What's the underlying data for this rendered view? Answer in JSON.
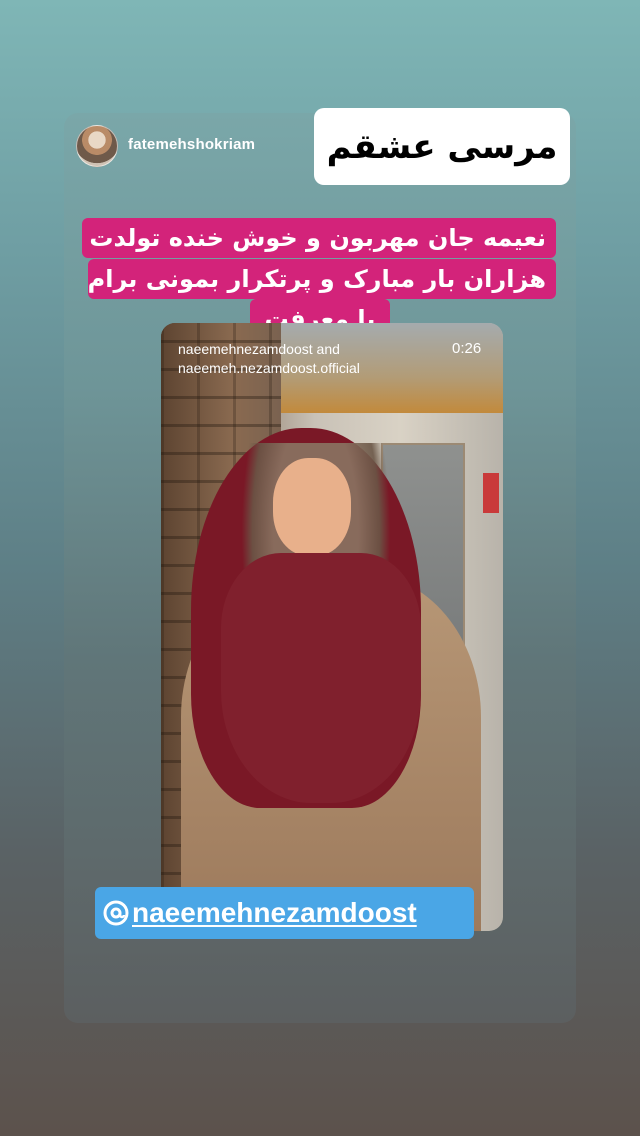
{
  "story": {
    "username": "fatemehshokriam",
    "white_sticker": "مرسی عشقم",
    "caption_lines": [
      "نعیمه جان مهربون و خوش خنده تولدت",
      "هزاران بار مبارک و پرتکرار بمونی برام",
      "با معرفت"
    ]
  },
  "reel": {
    "author_line1": "naeemehnezamdoost and",
    "author_line2": "naeemeh.nezamdoost.official",
    "duration": "0:26"
  },
  "mention": {
    "text": "naeemehnezamdoost",
    "icon": "threads-icon"
  },
  "colors": {
    "caption_bg": "#d3237a",
    "mention_bg": "#4aa6e6"
  }
}
